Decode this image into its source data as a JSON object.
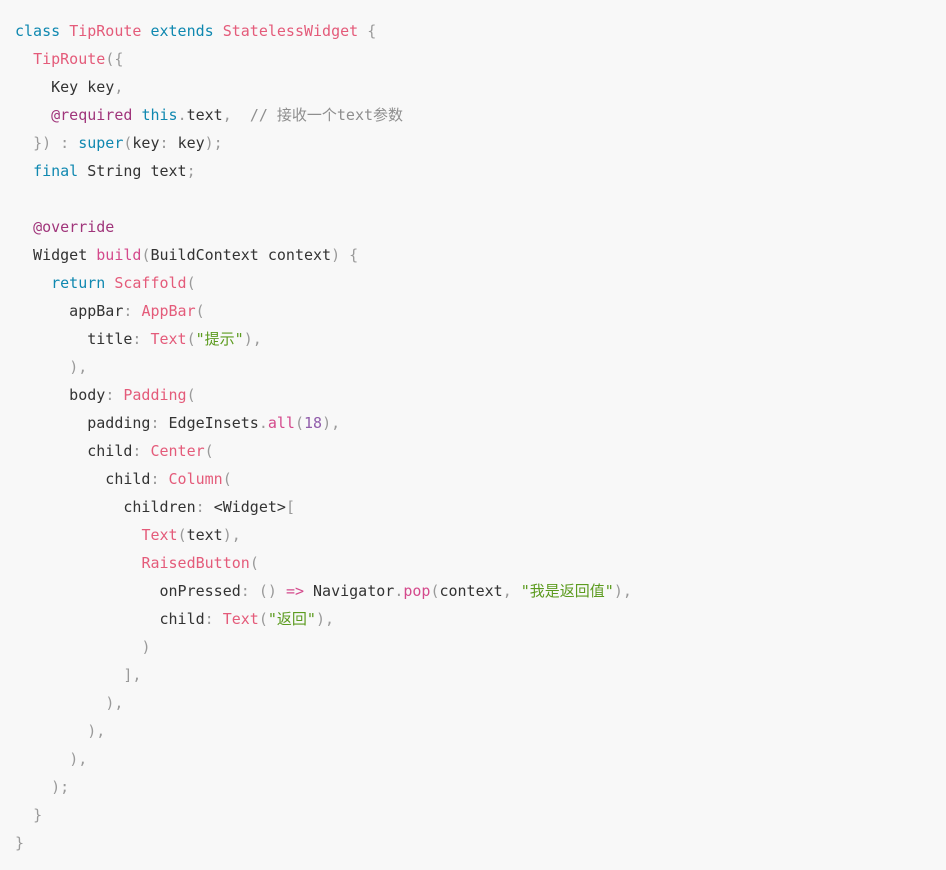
{
  "code": {
    "lines": [
      [
        [
          "kw",
          "class "
        ],
        [
          "cls",
          "TipRoute "
        ],
        [
          "kw",
          "extends "
        ],
        [
          "cls",
          "StatelessWidget "
        ],
        [
          "pn",
          "{"
        ]
      ],
      [
        [
          "tx",
          "  "
        ],
        [
          "cls",
          "TipRoute"
        ],
        [
          "pn",
          "({"
        ]
      ],
      [
        [
          "tx",
          "    Key key"
        ],
        [
          "pn",
          ","
        ]
      ],
      [
        [
          "tx",
          "    "
        ],
        [
          "ann",
          "@required "
        ],
        [
          "kw",
          "this"
        ],
        [
          "pn",
          "."
        ],
        [
          "tx",
          "text"
        ],
        [
          "pn",
          ","
        ],
        [
          "tx",
          "  "
        ],
        [
          "cm",
          "// 接收一个text参数"
        ]
      ],
      [
        [
          "tx",
          "  "
        ],
        [
          "pn",
          "}) : "
        ],
        [
          "kw",
          "super"
        ],
        [
          "pn",
          "("
        ],
        [
          "tx",
          "key"
        ],
        [
          "pn",
          ": "
        ],
        [
          "tx",
          "key"
        ],
        [
          "pn",
          ");"
        ]
      ],
      [
        [
          "tx",
          "  "
        ],
        [
          "kw",
          "final "
        ],
        [
          "tx",
          "String text"
        ],
        [
          "pn",
          ";"
        ]
      ],
      [
        [
          "tx",
          ""
        ]
      ],
      [
        [
          "tx",
          "  "
        ],
        [
          "ann",
          "@override"
        ]
      ],
      [
        [
          "tx",
          "  Widget "
        ],
        [
          "fn",
          "build"
        ],
        [
          "pn",
          "("
        ],
        [
          "tx",
          "BuildContext context"
        ],
        [
          "pn",
          ") {"
        ]
      ],
      [
        [
          "tx",
          "    "
        ],
        [
          "kw",
          "return "
        ],
        [
          "cls",
          "Scaffold"
        ],
        [
          "pn",
          "("
        ]
      ],
      [
        [
          "tx",
          "      appBar"
        ],
        [
          "pn",
          ": "
        ],
        [
          "cls",
          "AppBar"
        ],
        [
          "pn",
          "("
        ]
      ],
      [
        [
          "tx",
          "        title"
        ],
        [
          "pn",
          ": "
        ],
        [
          "cls",
          "Text"
        ],
        [
          "pn",
          "("
        ],
        [
          "str",
          "\"提示\""
        ],
        [
          "pn",
          "),"
        ]
      ],
      [
        [
          "tx",
          "      "
        ],
        [
          "pn",
          "),"
        ]
      ],
      [
        [
          "tx",
          "      body"
        ],
        [
          "pn",
          ": "
        ],
        [
          "cls",
          "Padding"
        ],
        [
          "pn",
          "("
        ]
      ],
      [
        [
          "tx",
          "        padding"
        ],
        [
          "pn",
          ": "
        ],
        [
          "tx",
          "EdgeInsets"
        ],
        [
          "pn",
          "."
        ],
        [
          "fn",
          "all"
        ],
        [
          "pn",
          "("
        ],
        [
          "num",
          "18"
        ],
        [
          "pn",
          "),"
        ]
      ],
      [
        [
          "tx",
          "        child"
        ],
        [
          "pn",
          ": "
        ],
        [
          "cls",
          "Center"
        ],
        [
          "pn",
          "("
        ]
      ],
      [
        [
          "tx",
          "          child"
        ],
        [
          "pn",
          ": "
        ],
        [
          "cls",
          "Column"
        ],
        [
          "pn",
          "("
        ]
      ],
      [
        [
          "tx",
          "            children"
        ],
        [
          "pn",
          ": "
        ],
        [
          "tx",
          "<Widget>"
        ],
        [
          "pn",
          "["
        ]
      ],
      [
        [
          "tx",
          "              "
        ],
        [
          "cls",
          "Text"
        ],
        [
          "pn",
          "("
        ],
        [
          "tx",
          "text"
        ],
        [
          "pn",
          "),"
        ]
      ],
      [
        [
          "tx",
          "              "
        ],
        [
          "cls",
          "RaisedButton"
        ],
        [
          "pn",
          "("
        ]
      ],
      [
        [
          "tx",
          "                onPressed"
        ],
        [
          "pn",
          ": () "
        ],
        [
          "fn",
          "=>"
        ],
        [
          "tx",
          " Navigator"
        ],
        [
          "pn",
          "."
        ],
        [
          "fn",
          "pop"
        ],
        [
          "pn",
          "("
        ],
        [
          "tx",
          "context"
        ],
        [
          "pn",
          ", "
        ],
        [
          "str",
          "\"我是返回值\""
        ],
        [
          "pn",
          "),"
        ]
      ],
      [
        [
          "tx",
          "                child"
        ],
        [
          "pn",
          ": "
        ],
        [
          "cls",
          "Text"
        ],
        [
          "pn",
          "("
        ],
        [
          "str",
          "\"返回\""
        ],
        [
          "pn",
          "),"
        ]
      ],
      [
        [
          "tx",
          "              "
        ],
        [
          "pn",
          ")"
        ]
      ],
      [
        [
          "tx",
          "            "
        ],
        [
          "pn",
          "],"
        ]
      ],
      [
        [
          "tx",
          "          "
        ],
        [
          "pn",
          "),"
        ]
      ],
      [
        [
          "tx",
          "        "
        ],
        [
          "pn",
          "),"
        ]
      ],
      [
        [
          "tx",
          "      "
        ],
        [
          "pn",
          "),"
        ]
      ],
      [
        [
          "tx",
          "    "
        ],
        [
          "pn",
          ");"
        ]
      ],
      [
        [
          "tx",
          "  "
        ],
        [
          "pn",
          "}"
        ]
      ],
      [
        [
          "pn",
          "}"
        ]
      ]
    ]
  }
}
